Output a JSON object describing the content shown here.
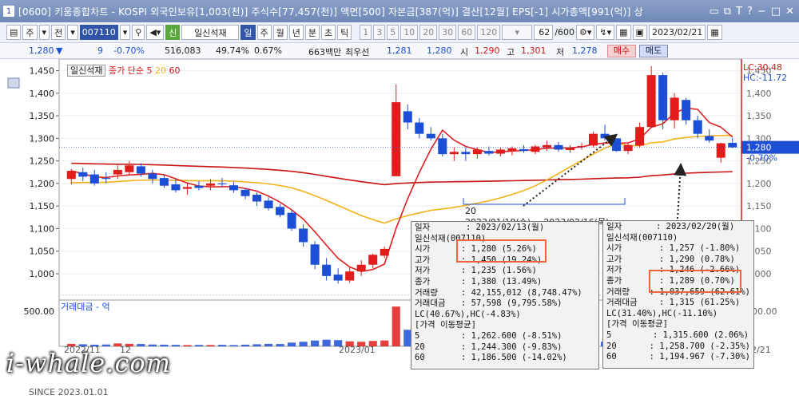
{
  "window": {
    "number": "1",
    "title": "[0600] 키움종합차트 - KOSPI 외국인보유[1,003(천)] 주식수[77,457(천)] 액면[500] 자본금[387(억)] 결산[12월] EPS[-1] 시가총액[991(억)] 상"
  },
  "toolbar": {
    "type_label": "주",
    "market_label": "전",
    "code_value": "007110",
    "stock_tag": "신",
    "stock_name": "일신석재",
    "period_buttons": [
      "일",
      "주",
      "월",
      "년",
      "분",
      "초",
      "틱"
    ],
    "interval_buttons": [
      "1",
      "3",
      "5",
      "10",
      "20",
      "30",
      "60",
      "120"
    ],
    "count_value": "62",
    "count_total": "/600",
    "date_value": "2023/02/21"
  },
  "quote": {
    "price": "1,280",
    "change_arrow": "▼",
    "change": "9",
    "change_pct": "-0.70%",
    "volume": "516,083",
    "ratio1": "49.74%",
    "ratio2": "0.67%",
    "amount": "663백만",
    "best_label": "최우선",
    "ask": "1,281",
    "bid": "1,280",
    "open_label": "시",
    "open": "1,290",
    "high_label": "고",
    "high": "1,301",
    "low_label": "저",
    "low": "1,278",
    "buy_label": "매수",
    "sell_label": "매도"
  },
  "chart_legend": {
    "stock_tag": "일신석재",
    "ma_label": "종가 단순",
    "ma5": "5",
    "ma20": "20",
    "ma60": "60",
    "volume_label": "거래대금 - 억"
  },
  "chart_data": {
    "type": "candlestick",
    "ylim": [
      970,
      1465
    ],
    "yticks": [
      1000,
      1050,
      1100,
      1150,
      1200,
      1250,
      1300,
      1350,
      1400,
      1450
    ],
    "ytick_labels": [
      "1,000",
      "1,050",
      "1,100",
      "1,150",
      "1,200",
      "1,250",
      "1,300",
      "1,350",
      "1,400",
      "1,450"
    ],
    "volume_tick": "500.00",
    "right_volume_tick": "500.00",
    "xlabels": [
      "2022/11",
      "12",
      "2023/01",
      "2/21"
    ],
    "current_price_label": "1,280",
    "current_change_label": "-0.70%",
    "lc_label": "LC:30.48",
    "hc_label": "HC:-11.72",
    "period_label": "20",
    "range_label": "2023/01/18(수) ~ 2023/02/16(목)",
    "candles": [
      [
        1210,
        1232,
        1198,
        1228
      ],
      [
        1225,
        1235,
        1205,
        1215
      ],
      [
        1220,
        1230,
        1195,
        1200
      ],
      [
        1212,
        1225,
        1200,
        1210
      ],
      [
        1220,
        1240,
        1210,
        1230
      ],
      [
        1225,
        1250,
        1220,
        1240
      ],
      [
        1238,
        1245,
        1215,
        1222
      ],
      [
        1222,
        1230,
        1200,
        1210
      ],
      [
        1212,
        1220,
        1190,
        1195
      ],
      [
        1198,
        1210,
        1180,
        1185
      ],
      [
        1188,
        1200,
        1175,
        1192
      ],
      [
        1195,
        1205,
        1185,
        1190
      ],
      [
        1195,
        1210,
        1185,
        1200
      ],
      [
        1200,
        1212,
        1192,
        1198
      ],
      [
        1196,
        1204,
        1180,
        1185
      ],
      [
        1186,
        1190,
        1165,
        1172
      ],
      [
        1175,
        1180,
        1150,
        1160
      ],
      [
        1162,
        1170,
        1140,
        1145
      ],
      [
        1148,
        1155,
        1125,
        1130
      ],
      [
        1135,
        1140,
        1095,
        1100
      ],
      [
        1100,
        1110,
        1060,
        1070
      ],
      [
        1065,
        1072,
        1010,
        1020
      ],
      [
        1020,
        1035,
        985,
        995
      ],
      [
        998,
        1012,
        978,
        985
      ],
      [
        985,
        1015,
        980,
        1005
      ],
      [
        1005,
        1030,
        995,
        1020
      ],
      [
        1020,
        1045,
        1012,
        1042
      ],
      [
        1040,
        1060,
        1035,
        1055
      ],
      [
        1216,
        1420,
        1216,
        1380
      ],
      [
        1360,
        1375,
        1320,
        1335
      ],
      [
        1335,
        1345,
        1300,
        1310
      ],
      [
        1310,
        1325,
        1295,
        1300
      ],
      [
        1300,
        1310,
        1260,
        1265
      ],
      [
        1265,
        1280,
        1250,
        1270
      ],
      [
        1270,
        1280,
        1250,
        1265
      ],
      [
        1265,
        1280,
        1255,
        1275
      ],
      [
        1272,
        1282,
        1262,
        1266
      ],
      [
        1266,
        1280,
        1260,
        1275
      ],
      [
        1272,
        1282,
        1262,
        1278
      ],
      [
        1276,
        1285,
        1268,
        1272
      ],
      [
        1270,
        1286,
        1265,
        1282
      ],
      [
        1280,
        1295,
        1272,
        1285
      ],
      [
        1285,
        1292,
        1270,
        1275
      ],
      [
        1274,
        1285,
        1268,
        1280
      ],
      [
        1282,
        1290,
        1275,
        1283
      ],
      [
        1284,
        1315,
        1280,
        1310
      ],
      [
        1310,
        1330,
        1295,
        1300
      ],
      [
        1300,
        1300,
        1270,
        1272
      ],
      [
        1272,
        1290,
        1265,
        1285
      ],
      [
        1284,
        1335,
        1280,
        1325
      ],
      [
        1325,
        1460,
        1323,
        1440
      ],
      [
        1440,
        1445,
        1320,
        1340
      ],
      [
        1340,
        1400,
        1322,
        1390
      ],
      [
        1385,
        1390,
        1330,
        1340
      ],
      [
        1340,
        1350,
        1300,
        1310
      ],
      [
        1305,
        1320,
        1290,
        1295
      ],
      [
        1257,
        1290,
        1246,
        1289
      ],
      [
        1290,
        1301,
        1278,
        1280
      ]
    ],
    "volume": [
      30,
      25,
      20,
      22,
      35,
      30,
      28,
      22,
      20,
      18,
      15,
      17,
      16,
      18,
      15,
      20,
      25,
      30,
      28,
      45,
      55,
      70,
      80,
      75,
      60,
      55,
      65,
      70,
      480,
      200,
      120,
      90,
      85,
      60,
      50,
      45,
      40,
      42,
      38,
      35,
      40,
      45,
      38,
      35,
      40,
      60,
      55,
      42,
      45,
      90,
      380,
      260,
      180,
      140,
      110,
      95,
      70,
      65
    ]
  },
  "tooltip1": {
    "title_k": "일자",
    "title_v": ": 2023/02/13(월)",
    "name": "일신석재(007110)",
    "rows": [
      {
        "k": "시가",
        "v": ": 1,280 (5.26%)"
      },
      {
        "k": "고가",
        "v": ": 1,450 (19.24%)"
      },
      {
        "k": "저가",
        "v": ": 1,235 (1.56%)"
      },
      {
        "k": "종가",
        "v": ": 1,380 (13.49%)"
      },
      {
        "k": "거래량",
        "v": ": 42,155,012 (8,748.47%)"
      },
      {
        "k": "거래대금",
        "v": ": 57,598 (9,795.58%)"
      }
    ],
    "lchc": "LC(40.67%),HC(-4.83%)",
    "ma_title": "[가격 이동평균]",
    "ma_rows": [
      {
        "k": "5",
        "v": ": 1,262.600 (-8.51%)"
      },
      {
        "k": "20",
        "v": ": 1,244.300 (-9.83%)"
      },
      {
        "k": "60",
        "v": ": 1,186.500 (-14.02%)"
      }
    ]
  },
  "tooltip2": {
    "title_k": "일자",
    "title_v": ": 2023/02/20(월)",
    "name": "일신석재(007110)",
    "rows": [
      {
        "k": "시가",
        "v": ": 1,257 (-1.80%)"
      },
      {
        "k": "고가",
        "v": ": 1,290 (0.78%)"
      },
      {
        "k": "저가",
        "v": ": 1,246 (-2.66%)"
      },
      {
        "k": "종가",
        "v": ": 1,289 (0.70%)"
      },
      {
        "k": "거래량",
        "v": ": 1,037,659 (62.61%)"
      },
      {
        "k": "거래대금",
        "v": ": 1,315 (61.25%)"
      }
    ],
    "lchc": "LC(31.40%),HC(-11.10%)",
    "ma_title": "[가격 이동평균]",
    "ma_rows": [
      {
        "k": "5",
        "v": ": 1,315.600 (2.06%)"
      },
      {
        "k": "20",
        "v": ": 1,258.700 (-2.35%)"
      },
      {
        "k": "60",
        "v": ": 1,194.967 (-7.30%)"
      }
    ]
  },
  "watermark": {
    "logo": "i-whale.com",
    "since": "SINCE 2023.01.01"
  },
  "colors": {
    "up": "#e21b1b",
    "down": "#1d4fd6",
    "ma5": "#e02020",
    "ma20": "#f2b21a",
    "ma60": "#c81414",
    "highlight": "#f0623a"
  }
}
